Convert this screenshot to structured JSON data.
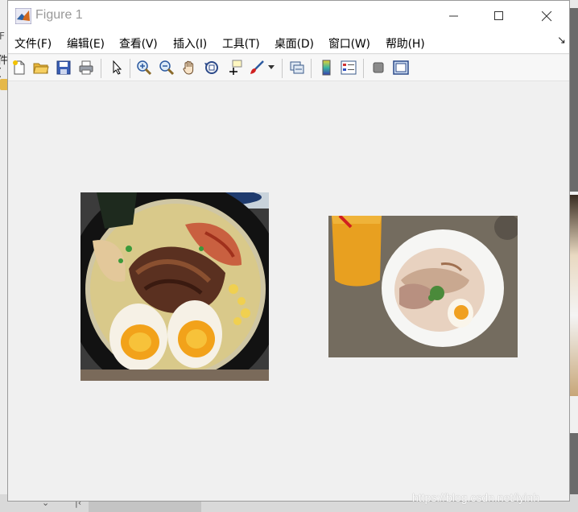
{
  "window": {
    "title": "Figure 1"
  },
  "menu": {
    "items": [
      "文件(F)",
      "编辑(E)",
      "查看(V)",
      "插入(I)",
      "工具(T)",
      "桌面(D)",
      "窗口(W)",
      "帮助(H)"
    ]
  },
  "toolbar": {
    "buttons": [
      "new-figure-icon",
      "open-file-icon",
      "save-icon",
      "print-icon",
      "edit-plot-arrow-icon",
      "zoom-in-icon",
      "zoom-out-icon",
      "pan-hand-icon",
      "rotate-3d-icon",
      "data-cursor-icon",
      "brush-icon",
      "brush-dropdown-icon",
      "link-plot-icon",
      "colorbar-icon",
      "legend-icon",
      "hide-plot-tools-icon",
      "show-plot-tools-icon"
    ]
  },
  "background": {
    "left_fragment_1": "F",
    "left_fragment_2": "件("
  },
  "images": [
    {
      "name": "ramen-bowl-closeup",
      "description": "bowl of ramen with chashu pork and soft-boiled eggs"
    },
    {
      "name": "ramen-bowl-table",
      "description": "white bowl of ramen with orange drink on table"
    }
  ],
  "watermark": "https://blog.csdn.net/iyinh",
  "colors": {
    "window_bg": "#f0f0f0",
    "titlebar": "#ffffff",
    "title_text": "#999999"
  }
}
